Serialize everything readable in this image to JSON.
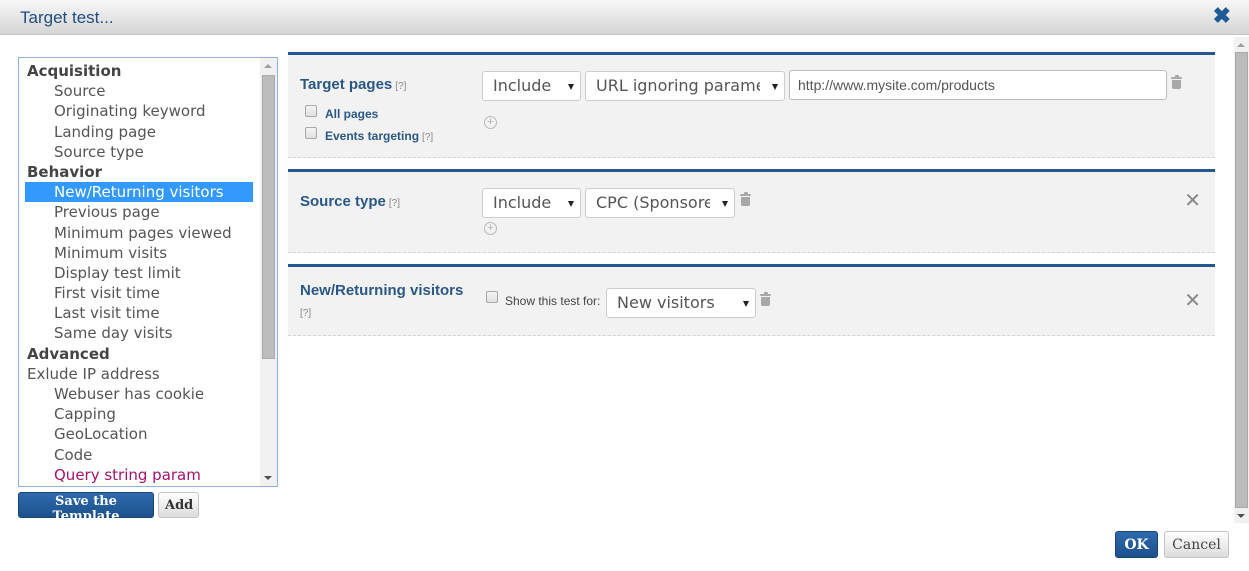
{
  "dialog": {
    "title": "Target test...",
    "close_icon": "close-x-icon"
  },
  "criteria_list": {
    "items": [
      {
        "label": "Acquisition",
        "type": "group"
      },
      {
        "label": "Source",
        "type": "item"
      },
      {
        "label": "Originating keyword",
        "type": "item"
      },
      {
        "label": "Landing page",
        "type": "item"
      },
      {
        "label": "Source type",
        "type": "item"
      },
      {
        "label": "Behavior",
        "type": "group"
      },
      {
        "label": "New/Returning visitors",
        "type": "item",
        "selected": true
      },
      {
        "label": "Previous page",
        "type": "item"
      },
      {
        "label": "Minimum pages viewed",
        "type": "item"
      },
      {
        "label": "Minimum visits",
        "type": "item"
      },
      {
        "label": "Display test limit",
        "type": "item"
      },
      {
        "label": "First visit time",
        "type": "item"
      },
      {
        "label": "Last visit time",
        "type": "item"
      },
      {
        "label": "Same day visits",
        "type": "item"
      },
      {
        "label": "Advanced",
        "type": "group"
      },
      {
        "label": "Exlude IP address",
        "type": "group-plain"
      },
      {
        "label": "Webuser has cookie",
        "type": "item"
      },
      {
        "label": "Capping",
        "type": "item"
      },
      {
        "label": "GeoLocation",
        "type": "item"
      },
      {
        "label": "Code",
        "type": "item"
      },
      {
        "label": "Query string param",
        "type": "item",
        "accent": true
      }
    ],
    "selected_color": "#3399ff",
    "accent_color": "#a0136d"
  },
  "buttons": {
    "save_template": "Save the Template",
    "add": "Add",
    "ok": "OK",
    "cancel": "Cancel"
  },
  "panels": {
    "target_pages": {
      "title": "Target pages",
      "help": "[?]",
      "include_select": "Include",
      "match_select": "URL ignoring parame",
      "url_value": "http://www.mysite.com/products",
      "all_pages_label": "All pages",
      "all_pages_checked": false,
      "events_targeting_label": "Events targeting",
      "events_help": "[?]"
    },
    "source_type": {
      "title": "Source type",
      "help": "[?]",
      "include_select": "Include",
      "type_select": "CPC (Sponsore"
    },
    "new_returning": {
      "title": "New/Returning visitors",
      "help": "[?]",
      "show_for_label": "Show this test for:",
      "show_for_checked": false,
      "visitor_select": "New visitors"
    }
  },
  "colors": {
    "panel_border": "#23598f",
    "title_text": "#2a5885",
    "primary_button": "#2d6aad"
  }
}
